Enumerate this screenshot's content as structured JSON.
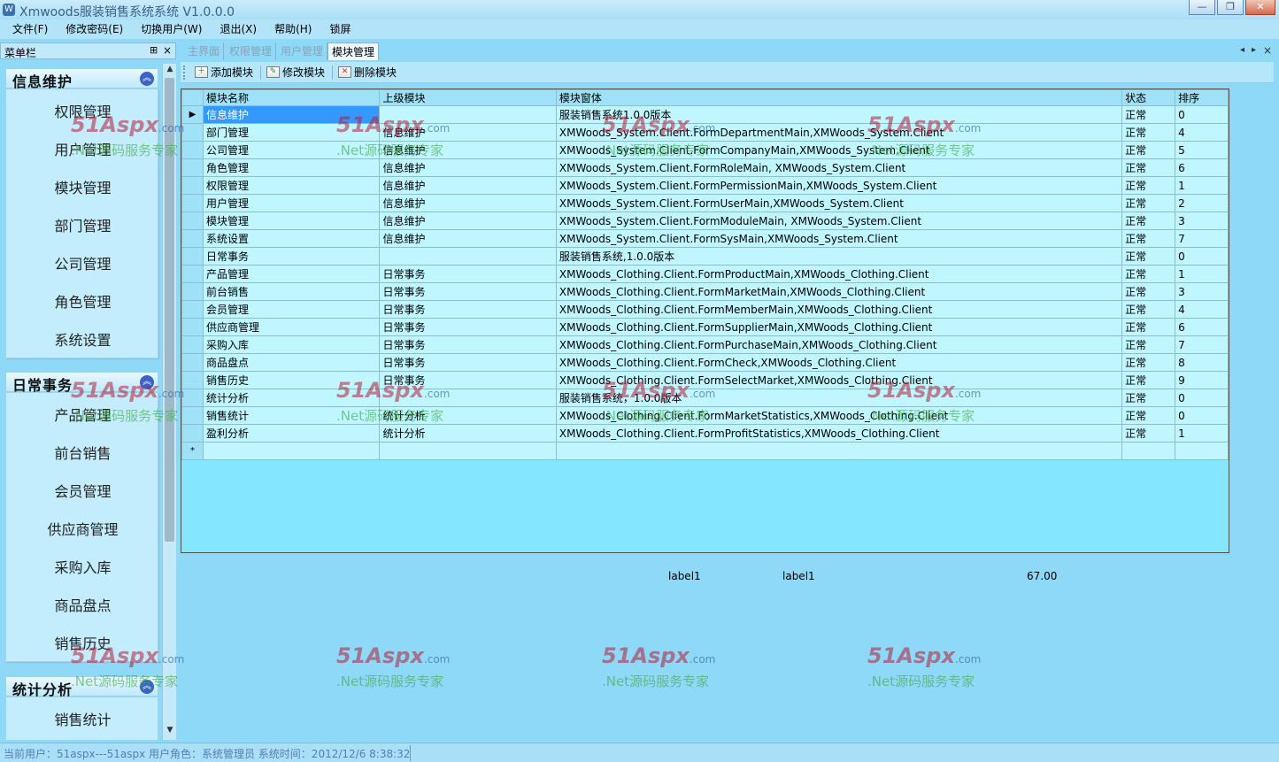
{
  "window": {
    "title": "Xmwoods服装销售系统系统 V1.0.0.0",
    "app_icon": "app-logo-icon",
    "controls": {
      "minimize": "—",
      "maximize": "❐",
      "close": "✕"
    }
  },
  "menubar": {
    "items": [
      "文件(F)",
      "修改密码(E)",
      "切换用户(W)",
      "退出(X)",
      "帮助(H)",
      "锁屏"
    ]
  },
  "sidebar": {
    "title": "菜单栏",
    "pin": "⊞",
    "close": "×",
    "groups": [
      {
        "title": "信息维护",
        "items": [
          "权限管理",
          "用户管理",
          "模块管理",
          "部门管理",
          "公司管理",
          "角色管理",
          "系统设置"
        ]
      },
      {
        "title": "日常事务",
        "items": [
          "产品管理",
          "前台销售",
          "会员管理",
          "供应商管理",
          "采购入库",
          "商品盘点",
          "销售历史"
        ]
      },
      {
        "title": "统计分析",
        "items": [
          "销售统计"
        ]
      }
    ]
  },
  "tabs": {
    "items": [
      "主界面",
      "权限管理",
      "用户管理",
      "模块管理"
    ],
    "active": "模块管理",
    "controls": [
      "◂",
      "▸",
      "×"
    ]
  },
  "toolbar": {
    "buttons": [
      {
        "label": "添加模块",
        "icon": "add-module-icon"
      },
      {
        "label": "修改模块",
        "icon": "edit-module-icon"
      },
      {
        "label": "删除模块",
        "icon": "delete-module-icon"
      }
    ]
  },
  "grid": {
    "columns": [
      "模块名称",
      "上级模块",
      "模块窗体",
      "状态",
      "排序"
    ],
    "rows": [
      [
        "信息维护",
        "",
        "服装销售系统1.0.0版本",
        "正常",
        "0"
      ],
      [
        "部门管理",
        "信息维护",
        "XMWoods_System.Client.FormDepartmentMain,XMWoods_System.Client",
        "正常",
        "4"
      ],
      [
        "公司管理",
        "信息维护",
        "XMWoods_System.Client.FormCompanyMain,XMWoods_System.Client",
        "正常",
        "5"
      ],
      [
        "角色管理",
        "信息维护",
        "XMWoods_System.Client.FormRoleMain, XMWoods_System.Client",
        "正常",
        "6"
      ],
      [
        "权限管理",
        "信息维护",
        "XMWoods_System.Client.FormPermissionMain,XMWoods_System.Client",
        "正常",
        "1"
      ],
      [
        "用户管理",
        "信息维护",
        "XMWoods_System.Client.FormUserMain,XMWoods_System.Client",
        "正常",
        "2"
      ],
      [
        "模块管理",
        "信息维护",
        "XMWoods_System.Client.FormModuleMain, XMWoods_System.Client",
        "正常",
        "3"
      ],
      [
        "系统设置",
        "信息维护",
        "XMWoods_System.Client.FormSysMain,XMWoods_System.Client",
        "正常",
        "7"
      ],
      [
        "日常事务",
        "",
        "服装销售系统,1.0.0版本",
        "正常",
        "0"
      ],
      [
        "产品管理",
        "日常事务",
        "XMWoods_Clothing.Client.FormProductMain,XMWoods_Clothing.Client",
        "正常",
        "1"
      ],
      [
        "前台销售",
        "日常事务",
        "XMWoods_Clothing.Client.FormMarketMain,XMWoods_Clothing.Client",
        "正常",
        "3"
      ],
      [
        "会员管理",
        "日常事务",
        "XMWoods_Clothing.Client.FormMemberMain,XMWoods_Clothing.Client",
        "正常",
        "4"
      ],
      [
        "供应商管理",
        "日常事务",
        "XMWoods_Clothing.Client.FormSupplierMain,XMWoods_Clothing.Client",
        "正常",
        "6"
      ],
      [
        "采购入库",
        "日常事务",
        "XMWoods_Clothing.Client.FormPurchaseMain,XMWoods_Clothing.Client",
        "正常",
        "7"
      ],
      [
        "商品盘点",
        "日常事务",
        "XMWoods_Clothing.Client.FormCheck,XMWoods_Clothing.Client",
        "正常",
        "8"
      ],
      [
        "销售历史",
        "日常事务",
        "XMWoods_Clothing.Client.FormSelectMarket,XMWoods_Clothing.Client",
        "正常",
        "9"
      ],
      [
        "统计分析",
        "",
        "服装销售系统，1.0.0版本",
        "正常",
        "0"
      ],
      [
        "销售统计",
        "统计分析",
        "XMWoods_Clothing.Client.FormMarketStatistics,XMWoods_Clothing.Client",
        "正常",
        "0"
      ],
      [
        "盈利分析",
        "统计分析",
        "XMWoods_Clothing.Client.FormProfitStatistics,XMWoods_Clothing.Client",
        "正常",
        "1"
      ]
    ],
    "current_row_marker": "▶",
    "new_row_marker": "*"
  },
  "info_labels": [
    "label1",
    "label1",
    "67.00"
  ],
  "statusbar": {
    "text": "当前用户：51aspx---51aspx  用户角色：系统管理员  系统时间：2012/12/6 8:38:32"
  },
  "watermark": {
    "logo": "51Aspx",
    "domain": ".com",
    "tagline": ".Net源码服务专家"
  },
  "colors": {
    "background": "#8ed8f8",
    "grid_cell": "#bff6ff",
    "grid_header": "#9fe1f6",
    "selection": "#3399ff",
    "collapse_button": "#3a64c4"
  }
}
